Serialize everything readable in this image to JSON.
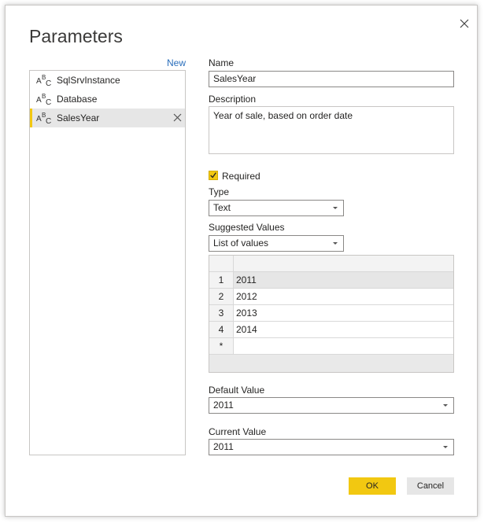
{
  "dialog": {
    "title": "Parameters",
    "new_link": "New"
  },
  "params": [
    {
      "label": "SqlSrvInstance",
      "icon": "abc-text-type-icon"
    },
    {
      "label": "Database",
      "icon": "abc-text-type-icon"
    },
    {
      "label": "SalesYear",
      "icon": "abc-text-type-icon"
    }
  ],
  "form": {
    "name_label": "Name",
    "name_value": "SalesYear",
    "description_label": "Description",
    "description_value": "Year of sale, based on order date",
    "required_label": "Required",
    "required_checked": true,
    "type_label": "Type",
    "type_value": "Text",
    "suggested_label": "Suggested Values",
    "suggested_value": "List of values",
    "values_rows": [
      {
        "num": "1",
        "value": "2011"
      },
      {
        "num": "2",
        "value": "2012"
      },
      {
        "num": "3",
        "value": "2013"
      },
      {
        "num": "4",
        "value": "2014"
      },
      {
        "num": "*",
        "value": ""
      }
    ],
    "default_label": "Default Value",
    "default_value": "2011",
    "current_label": "Current Value",
    "current_value": "2011"
  },
  "buttons": {
    "ok": "OK",
    "cancel": "Cancel"
  },
  "colors": {
    "accent": "#f2c811",
    "link": "#2a6ebb"
  }
}
